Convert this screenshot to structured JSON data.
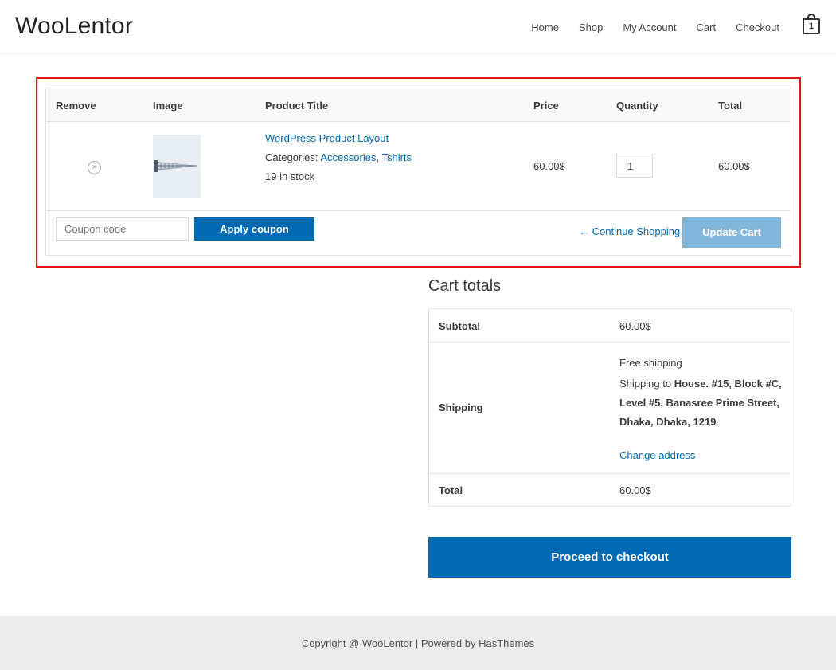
{
  "site": {
    "logo": "WooLentor"
  },
  "nav": {
    "items": [
      "Home",
      "Shop",
      "My Account",
      "Cart",
      "Checkout"
    ],
    "cart_count": "1"
  },
  "cart_table": {
    "headers": {
      "remove": "Remove",
      "image": "Image",
      "title": "Product Title",
      "price": "Price",
      "quantity": "Quantity",
      "total": "Total"
    },
    "items": [
      {
        "remove_icon": "×",
        "title": "WordPress Product Layout",
        "categories_label": "Categories:",
        "categories": [
          "Accessories",
          "Tshirts"
        ],
        "stock": "19 in stock",
        "price": "60.00$",
        "quantity": "1",
        "total": "60.00$"
      }
    ],
    "coupon_placeholder": "Coupon code",
    "apply_label": "Apply coupon",
    "continue_label": "← Continue Shopping",
    "update_label": "Update Cart"
  },
  "totals": {
    "title": "Cart totals",
    "subtotal_label": "Subtotal",
    "subtotal_value": "60.00$",
    "shipping_label": "Shipping",
    "shipping_method": "Free shipping",
    "shipping_to_prefix": "Shipping to",
    "shipping_address": "House. #15, Block #C, Level #5, Banasree Prime Street, Dhaka, Dhaka, 1219",
    "change_address": "Change address",
    "total_label": "Total",
    "total_value": "60.00$"
  },
  "checkout_label": "Proceed to checkout",
  "footer": {
    "text": "Copyright @ WooLentor | Powered by HasThemes"
  },
  "colors": {
    "primary": "#0069b3",
    "disabled_button": "#82b6db",
    "highlight_border": "#e3151a",
    "footer_bg": "#ececec"
  }
}
